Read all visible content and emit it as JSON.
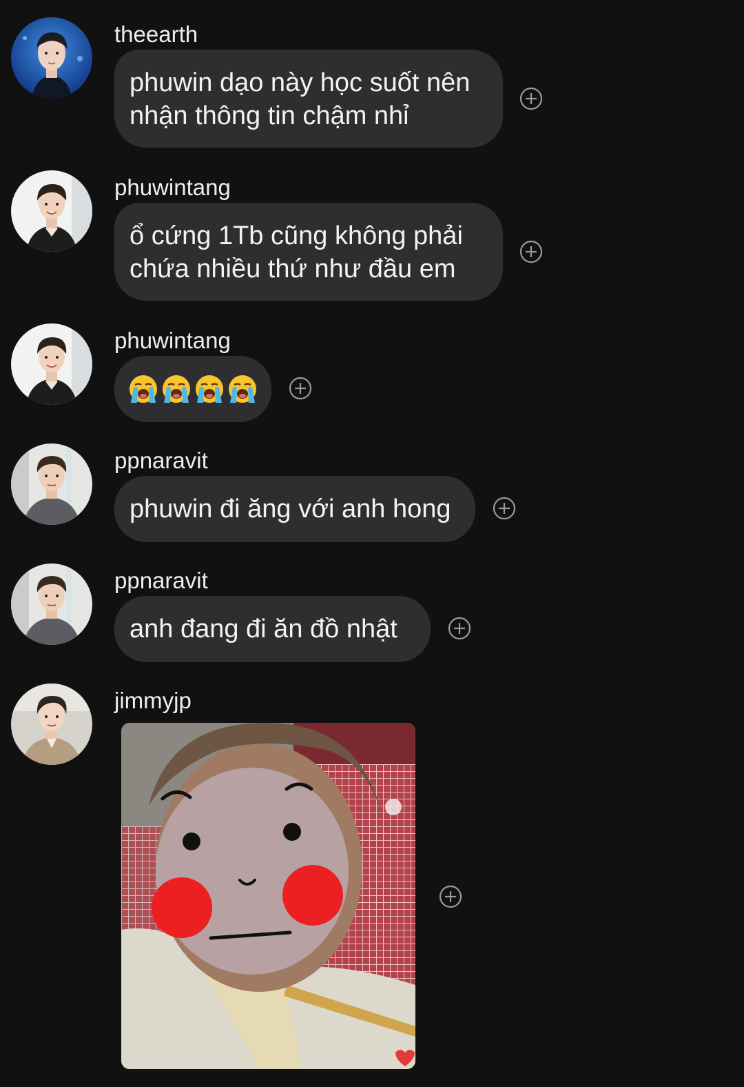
{
  "messages": [
    {
      "username": "theearth",
      "lines": [
        "phuwin dạo này học suốt nên",
        "nhận thông tin chậm nhỉ"
      ]
    },
    {
      "username": "phuwintang",
      "lines": [
        "ổ cứng 1Tb cũng không phải",
        "chứa nhiều thứ như đầu em"
      ]
    },
    {
      "username": "phuwintang",
      "emoji_count": 4
    },
    {
      "username": "ppnaravit",
      "lines": [
        "phuwin đi ăng với anh hong"
      ]
    },
    {
      "username": "ppnaravit",
      "lines": [
        "anh đang đi ăn đồ nhật"
      ]
    },
    {
      "username": "jimmyjp",
      "attachment": "photo"
    }
  ],
  "icons": {
    "react": "plus-circle-icon",
    "emoji": "loudly-crying-face-icon"
  },
  "colors": {
    "background": "#111112",
    "bubble": "#2e2e30",
    "text": "#f3f3f3",
    "icon": "#9a9a9a"
  }
}
